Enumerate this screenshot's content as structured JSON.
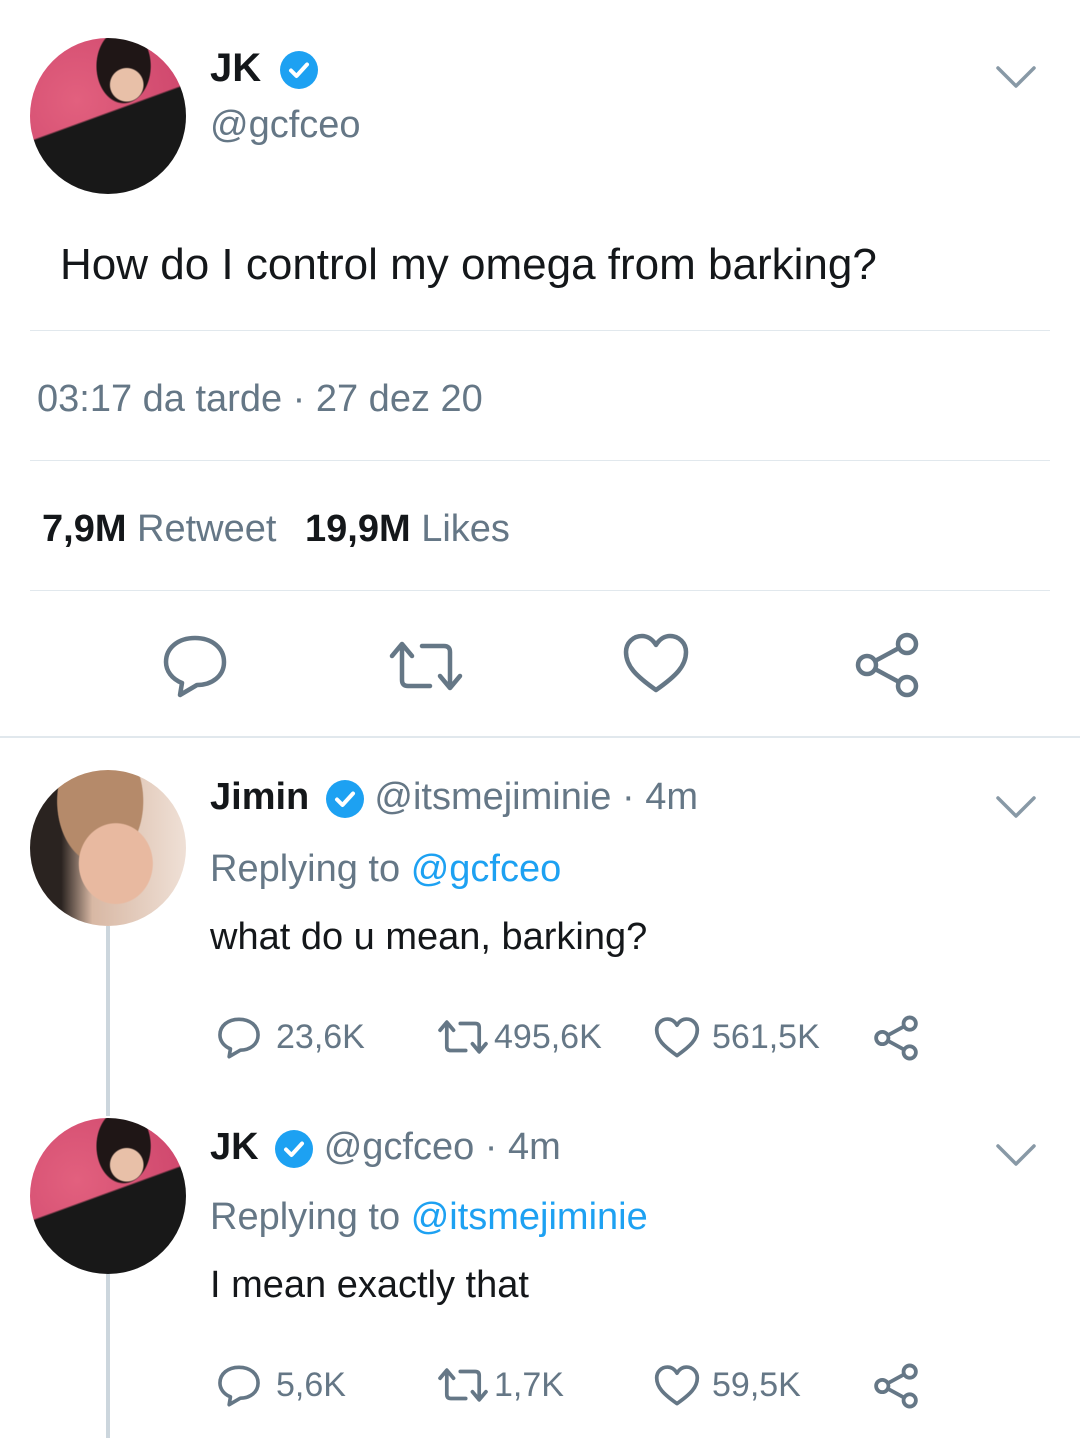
{
  "main_tweet": {
    "display_name": "JK",
    "handle": "@gcfceo",
    "text": "How do I control my omega from barking?",
    "timestamp": "03:17 da tarde · 27 dez 20",
    "retweet_count": "7,9M",
    "retweet_label": "Retweet",
    "like_count": "19,9M",
    "like_label": "Likes"
  },
  "replies": [
    {
      "display_name": "Jimin",
      "handle": "@itsmejiminie · 4m",
      "replying_prefix": "Replying to",
      "replying_to": "@gcfceo",
      "text": "what do u mean, barking?",
      "comments": "23,6K",
      "retweets": "495,6K",
      "likes": "561,5K"
    },
    {
      "display_name": "JK",
      "handle": "@gcfceo · 4m",
      "replying_prefix": "Replying to",
      "replying_to": "@itsmejiminie",
      "text": "I mean exactly that",
      "comments": "5,6K",
      "retweets": "1,7K",
      "likes": "59,5K"
    }
  ],
  "colors": {
    "accent": "#1da1f2",
    "muted": "#657786",
    "divider": "#e1e8ed"
  },
  "icons": [
    "verified-icon",
    "chevron-down-icon",
    "reply-icon",
    "retweet-icon",
    "like-icon",
    "share-icon"
  ]
}
